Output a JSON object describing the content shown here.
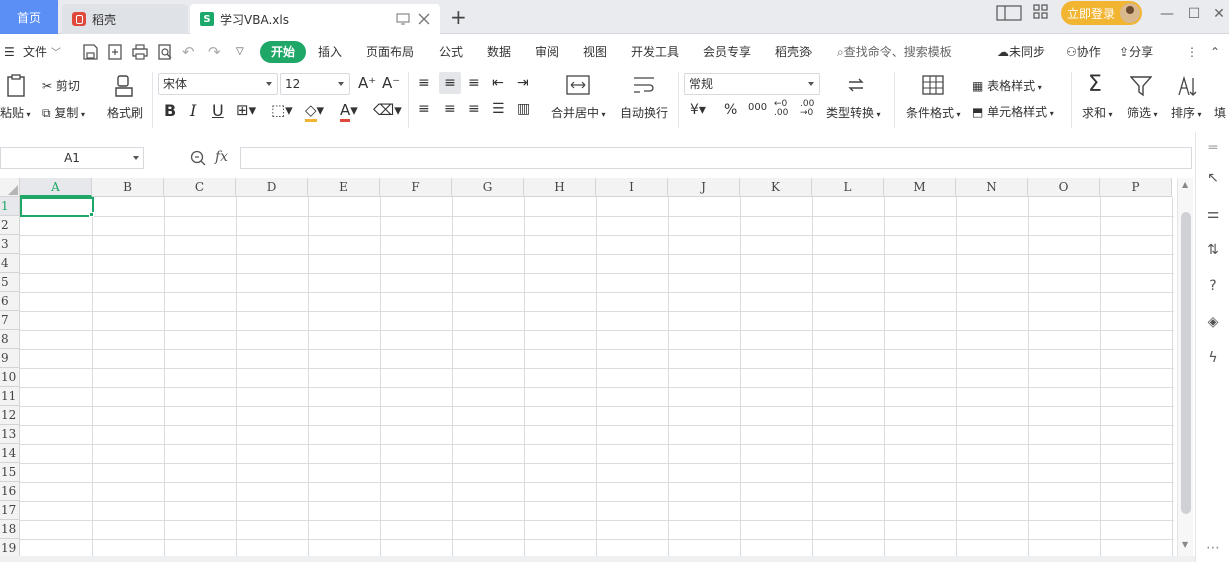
{
  "titlebar": {
    "home_tab": "首页",
    "daoke_tab": "稻壳",
    "file_tab": "学习VBA.xls",
    "new_tab": "+",
    "login": "立即登录"
  },
  "menu": {
    "file": "文件",
    "start": "开始",
    "items": [
      "插入",
      "页面布局",
      "公式",
      "数据",
      "审阅",
      "视图",
      "开发工具",
      "会员专享",
      "稻壳资"
    ],
    "search": "查找命令、搜索模板",
    "unsynced": "未同步",
    "collab": "协作",
    "share": "分享"
  },
  "ribbon": {
    "cut": "剪切",
    "paste": "粘贴",
    "copy": "复制",
    "format_painter": "格式刷",
    "font_name": "宋体",
    "font_size": "12",
    "merge_center": "合并居中",
    "wrap_text": "自动换行",
    "number_format": "常规",
    "type_convert": "类型转换",
    "cond_format": "条件格式",
    "table_style": "表格样式",
    "cell_style": "单元格样式",
    "sum": "求和",
    "filter": "筛选",
    "sort": "排序",
    "fill": "填"
  },
  "formula": {
    "name_box": "A1",
    "fx": "fx"
  },
  "sheet": {
    "columns": [
      "A",
      "B",
      "C",
      "D",
      "E",
      "F",
      "G",
      "H",
      "I",
      "J",
      "K",
      "L",
      "M",
      "N",
      "O",
      "P"
    ],
    "rows": [
      "1",
      "2",
      "3",
      "4",
      "5",
      "6",
      "7",
      "8",
      "9",
      "10",
      "11",
      "12",
      "13",
      "14",
      "15",
      "16",
      "17",
      "18",
      "19"
    ],
    "selected_cell": "A1"
  },
  "colors": {
    "accent_green": "#1ea766",
    "home_blue": "#5b8ff5",
    "login_gold": "#f2b532"
  }
}
